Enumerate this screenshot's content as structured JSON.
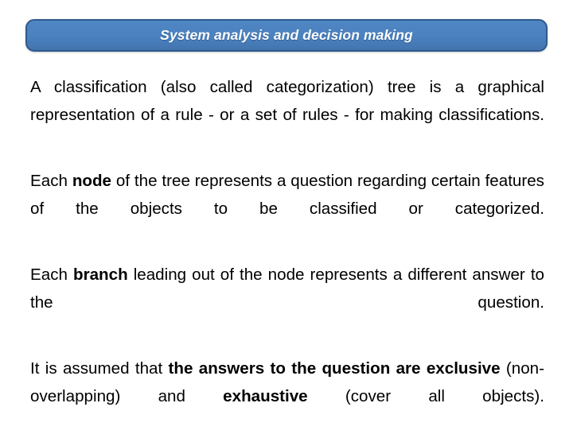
{
  "slide": {
    "background_color": "#ffffff",
    "title_banner": {
      "text": "System analysis and decision making",
      "fill_color": "#4a81bf",
      "border_color": "#2e5a8e",
      "text_color": "#ffffff"
    },
    "paragraphs": [
      {
        "id": "p1",
        "justified": true,
        "runs": [
          {
            "text": "A classification (also called categorization) tree is a graphical representation of a rule - or a set of rules - for making classifications.",
            "bold": false
          }
        ]
      },
      {
        "id": "p2",
        "justified": true,
        "runs": [
          {
            "text": "Each ",
            "bold": false
          },
          {
            "text": "node",
            "bold": true
          },
          {
            "text": " of the tree represents a question regarding certain features of the objects to be classified or categorized.",
            "bold": false
          }
        ]
      },
      {
        "id": "p3",
        "justified": true,
        "runs": [
          {
            "text": "Each ",
            "bold": false
          },
          {
            "text": "branch",
            "bold": true
          },
          {
            "text": " leading out of the node represents a different answer to the question.",
            "bold": false
          }
        ]
      },
      {
        "id": "p4",
        "justified": true,
        "runs": [
          {
            "text": "It is assumed that ",
            "bold": false
          },
          {
            "text": "the answers to the question are exclusive",
            "bold": true
          },
          {
            "text": " (non-overlapping) and ",
            "bold": false
          },
          {
            "text": "exhaustive",
            "bold": true
          },
          {
            "text": " (cover all objects).",
            "bold": false
          }
        ]
      }
    ]
  }
}
